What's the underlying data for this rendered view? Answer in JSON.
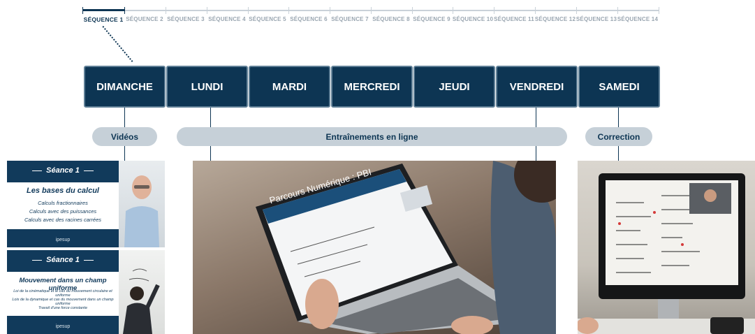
{
  "sequences": [
    {
      "label": "SÉQUENCE 1",
      "active": true
    },
    {
      "label": "SÉQUENCE 2",
      "active": false
    },
    {
      "label": "SÉQUENCE 3",
      "active": false
    },
    {
      "label": "SÉQUENCE 4",
      "active": false
    },
    {
      "label": "SÉQUENCE 5",
      "active": false
    },
    {
      "label": "SÉQUENCE 6",
      "active": false
    },
    {
      "label": "SÉQUENCE 7",
      "active": false
    },
    {
      "label": "SÉQUENCE 8",
      "active": false
    },
    {
      "label": "SÉQUENCE 9",
      "active": false
    },
    {
      "label": "SÉQUENCE 10",
      "active": false
    },
    {
      "label": "SÉQUENCE 11",
      "active": false
    },
    {
      "label": "SÉQUENCE 12",
      "active": false
    },
    {
      "label": "SÉQUENCE 13",
      "active": false
    },
    {
      "label": "SÉQUENCE 14",
      "active": false
    }
  ],
  "days": [
    "DIMANCHE",
    "LUNDI",
    "MARDI",
    "MERCREDI",
    "JEUDI",
    "VENDREDI",
    "SAMEDI"
  ],
  "phases": {
    "videos": "Vidéos",
    "training": "Entraînements en ligne",
    "correction": "Correction"
  },
  "video1": {
    "header": "Séance 1",
    "title": "Les bases du calcul",
    "lines": [
      "Calculs fractionnaires",
      "Calculs avec des puissances",
      "Calculs avec des racines carrées"
    ],
    "logo": "ipesup"
  },
  "video2": {
    "header": "Séance 1",
    "title": "Mouvement dans un champ uniforme",
    "lines": [
      "Loi de la cinématique et le cas du mouvement circulaire et uniforme",
      "Lois de la dynamique et cas du mouvement dans un champ uniforme",
      "Travail d'une force constante"
    ],
    "logo": "ipesup"
  },
  "laptop_screen": {
    "title": "Parcours Numérique : PBI"
  },
  "colors": {
    "navy": "#0d3553",
    "pill": "#c6d0d8",
    "inactive": "#9aa6b1"
  }
}
